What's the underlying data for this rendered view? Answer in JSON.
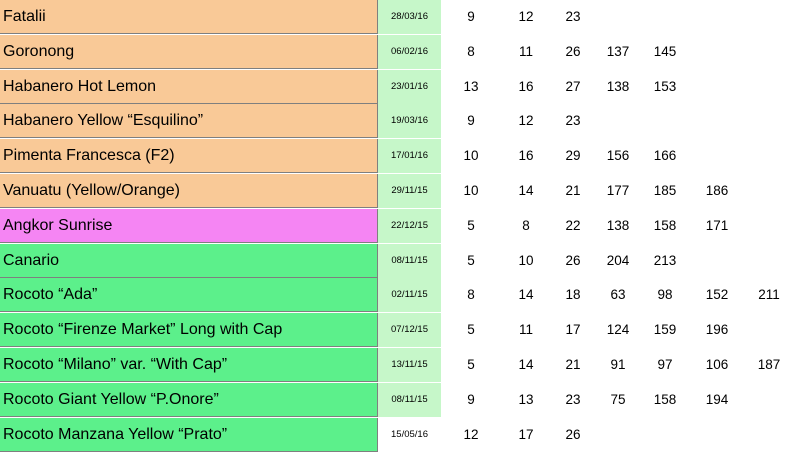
{
  "colors": {
    "orange": "#f9c997",
    "pink": "#f585f3",
    "green": "#5cf08b",
    "date_green": "#c6f7c9",
    "white": "#ffffff",
    "border": "#7f7f7f"
  },
  "rows": [
    {
      "name": "Fatalii",
      "date": "28/03/16",
      "color": "orange",
      "date_color": "date_green",
      "values": [
        "9",
        "12",
        "23",
        "",
        "",
        "",
        ""
      ]
    },
    {
      "name": "Goronong",
      "date": "06/02/16",
      "color": "orange",
      "date_color": "date_green",
      "values": [
        "8",
        "11",
        "26",
        "137",
        "145",
        "",
        ""
      ]
    },
    {
      "name": "Habanero Hot Lemon",
      "date": "23/01/16",
      "color": "orange",
      "date_color": "date_green",
      "values": [
        "13",
        "16",
        "27",
        "138",
        "153",
        "",
        ""
      ]
    },
    {
      "name": "Habanero Yellow “Esquilino”",
      "date": "19/03/16",
      "color": "orange",
      "date_color": "date_green",
      "values": [
        "9",
        "12",
        "23",
        "",
        "",
        "",
        ""
      ]
    },
    {
      "name": "Pimenta Francesca (F2)",
      "date": "17/01/16",
      "color": "orange",
      "date_color": "date_green",
      "values": [
        "10",
        "16",
        "29",
        "156",
        "166",
        "",
        ""
      ]
    },
    {
      "name": "Vanuatu (Yellow/Orange)",
      "date": "29/11/15",
      "color": "orange",
      "date_color": "date_green",
      "values": [
        "10",
        "14",
        "21",
        "177",
        "185",
        "186",
        ""
      ]
    },
    {
      "name": "Angkor Sunrise",
      "date": "22/12/15",
      "color": "pink",
      "date_color": "date_green",
      "values": [
        "5",
        "8",
        "22",
        "138",
        "158",
        "171",
        ""
      ]
    },
    {
      "name": "Canario",
      "date": "08/11/15",
      "color": "green",
      "date_color": "date_green",
      "values": [
        "5",
        "10",
        "26",
        "204",
        "213",
        "",
        ""
      ]
    },
    {
      "name": "Rocoto “Ada”",
      "date": "02/11/15",
      "color": "green",
      "date_color": "date_green",
      "values": [
        "8",
        "14",
        "18",
        "63",
        "98",
        "152",
        "211"
      ]
    },
    {
      "name": "Rocoto “Firenze Market” Long with Cap",
      "date": "07/12/15",
      "color": "green",
      "date_color": "date_green",
      "values": [
        "5",
        "11",
        "17",
        "124",
        "159",
        "196",
        ""
      ]
    },
    {
      "name": "Rocoto “Milano” var. “With Cap”",
      "date": "13/11/15",
      "color": "green",
      "date_color": "date_green",
      "values": [
        "5",
        "14",
        "21",
        "91",
        "97",
        "106",
        "187"
      ]
    },
    {
      "name": "Rocoto Giant Yellow “P.Onore”",
      "date": "08/11/15",
      "color": "green",
      "date_color": "date_green",
      "values": [
        "9",
        "13",
        "23",
        "75",
        "158",
        "194",
        ""
      ]
    },
    {
      "name": "Rocoto Manzana Yellow “Prato”",
      "date": "15/05/16",
      "color": "green",
      "date_color": "white",
      "values": [
        "12",
        "17",
        "26",
        "",
        "",
        "",
        ""
      ]
    }
  ]
}
